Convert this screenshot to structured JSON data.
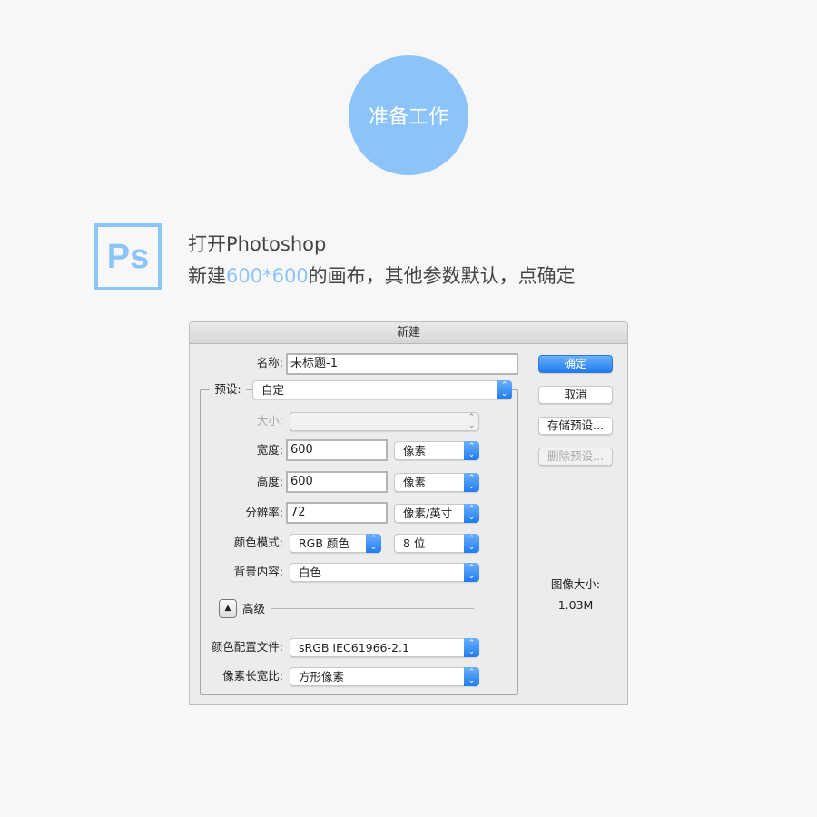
{
  "header": {
    "badge": "准备工作"
  },
  "logo": {
    "text": "Ps",
    "color": "#8cc4f9"
  },
  "intro": {
    "line1": "打开Photoshop",
    "line2_pre": "新建",
    "line2_highlight": "600*600",
    "line2_post": "的画布，其他参数默认，点确定"
  },
  "dialog": {
    "title": "新建",
    "name_label": "名称:",
    "name_value": "未标题-1",
    "preset_label": "预设:",
    "preset_value": "自定",
    "size_label": "大小:",
    "size_value": "",
    "width_label": "宽度:",
    "width_value": "600",
    "width_unit": "像素",
    "height_label": "高度:",
    "height_value": "600",
    "height_unit": "像素",
    "resolution_label": "分辨率:",
    "resolution_value": "72",
    "resolution_unit": "像素/英寸",
    "color_mode_label": "颜色模式:",
    "color_mode_value": "RGB 颜色",
    "bit_depth": "8 位",
    "background_label": "背景内容:",
    "background_value": "白色",
    "advanced_label": "高级",
    "profile_label": "颜色配置文件:",
    "profile_value": "sRGB IEC61966-2.1",
    "aspect_label": "像素长宽比:",
    "aspect_value": "方形像素",
    "buttons": {
      "ok": "确定",
      "cancel": "取消",
      "save_preset": "存储预设...",
      "delete_preset": "删除预设..."
    },
    "image_size_label": "图像大小:",
    "image_size_value": "1.03M"
  }
}
